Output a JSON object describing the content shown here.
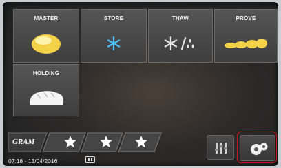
{
  "tiles": {
    "master": {
      "label": "MASTER",
      "icon": "bread-loaf-yellow-icon"
    },
    "store": {
      "label": "STORE",
      "icon": "snowflake-icon"
    },
    "thaw": {
      "label": "THAW",
      "icon": "snowflake-drops-icon"
    },
    "prove": {
      "label": "PROVE",
      "icon": "bread-rolls-icon"
    },
    "holding": {
      "label": "HOLDING",
      "icon": "bread-loaf-white-icon"
    }
  },
  "brand": {
    "logo_text": "GRAM"
  },
  "favorites": {
    "icon": "star-icon",
    "count": 3
  },
  "status": {
    "datetime": "07:18 - 13/04/2016"
  },
  "colors": {
    "accent_blue": "#4fc3ff",
    "bread_yellow": "#f3d24a",
    "highlight_red": "#c4161c"
  }
}
